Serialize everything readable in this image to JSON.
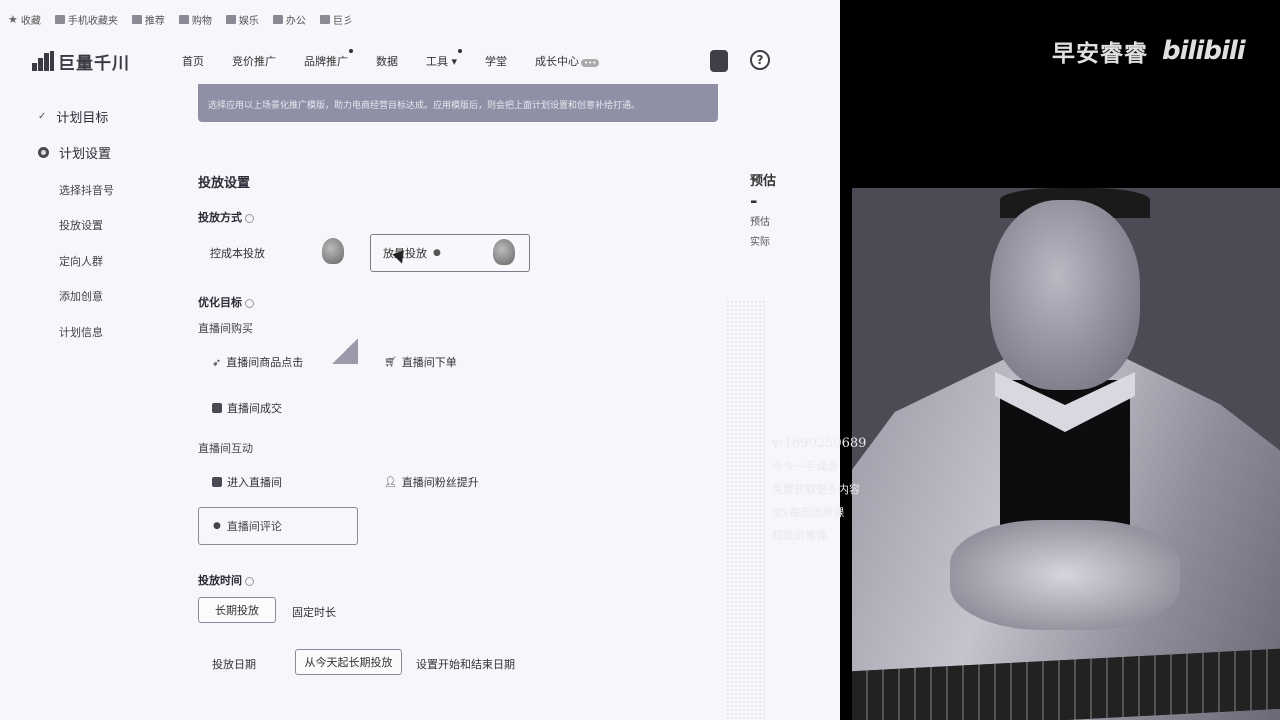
{
  "bookmarks": {
    "items": [
      "收藏",
      "手机收藏夹",
      "推荐",
      "购物",
      "娱乐",
      "办公",
      "巨彡"
    ]
  },
  "topnav": {
    "logo_text": "巨量千川",
    "menu": [
      "首页",
      "竞价推广",
      "品牌推广",
      "数据",
      "工具",
      "学堂",
      "成长中心"
    ],
    "help_glyph": "?"
  },
  "sidebar": {
    "steps": [
      "计划目标",
      "计划设置"
    ],
    "subs": [
      "选择抖音号",
      "投放设置",
      "定向人群",
      "添加创意",
      "计划信息"
    ]
  },
  "main": {
    "banner": "选择应用以上场景化推广模版，助力电商经营目标达成。应用模版后，则会把上面计划设置和创意补给打通。",
    "section_title": "投放设置",
    "delivery_mode": {
      "label": "投放方式",
      "options": [
        "控成本投放",
        "放量投放"
      ]
    },
    "optimize": {
      "label": "优化目标",
      "group1_label": "直播间购买",
      "group1_options": [
        "直播间商品点击",
        "直播间下单",
        "直播间成交"
      ],
      "group2_label": "直播间互动",
      "group2_options": [
        "进入直播间",
        "直播间粉丝提升",
        "直播间评论"
      ]
    },
    "time": {
      "label": "投放时间",
      "mode_selected": "长期投放",
      "mode_other": "固定时长",
      "date_label": "投放日期",
      "date_selected": "从今天起长期投放",
      "date_other": "设置开始和结束日期"
    }
  },
  "right_panel": {
    "title": "预估",
    "value": "-",
    "notes": [
      "预估",
      "实际"
    ]
  },
  "video": {
    "brand_name": "早安睿睿",
    "brand_logo": "bilibili",
    "wechat_lines": [
      "v:1690259689",
      "今今一手课源",
      "免费获取更多内容",
      "加v每周送新课",
      "超低价筹课"
    ]
  }
}
